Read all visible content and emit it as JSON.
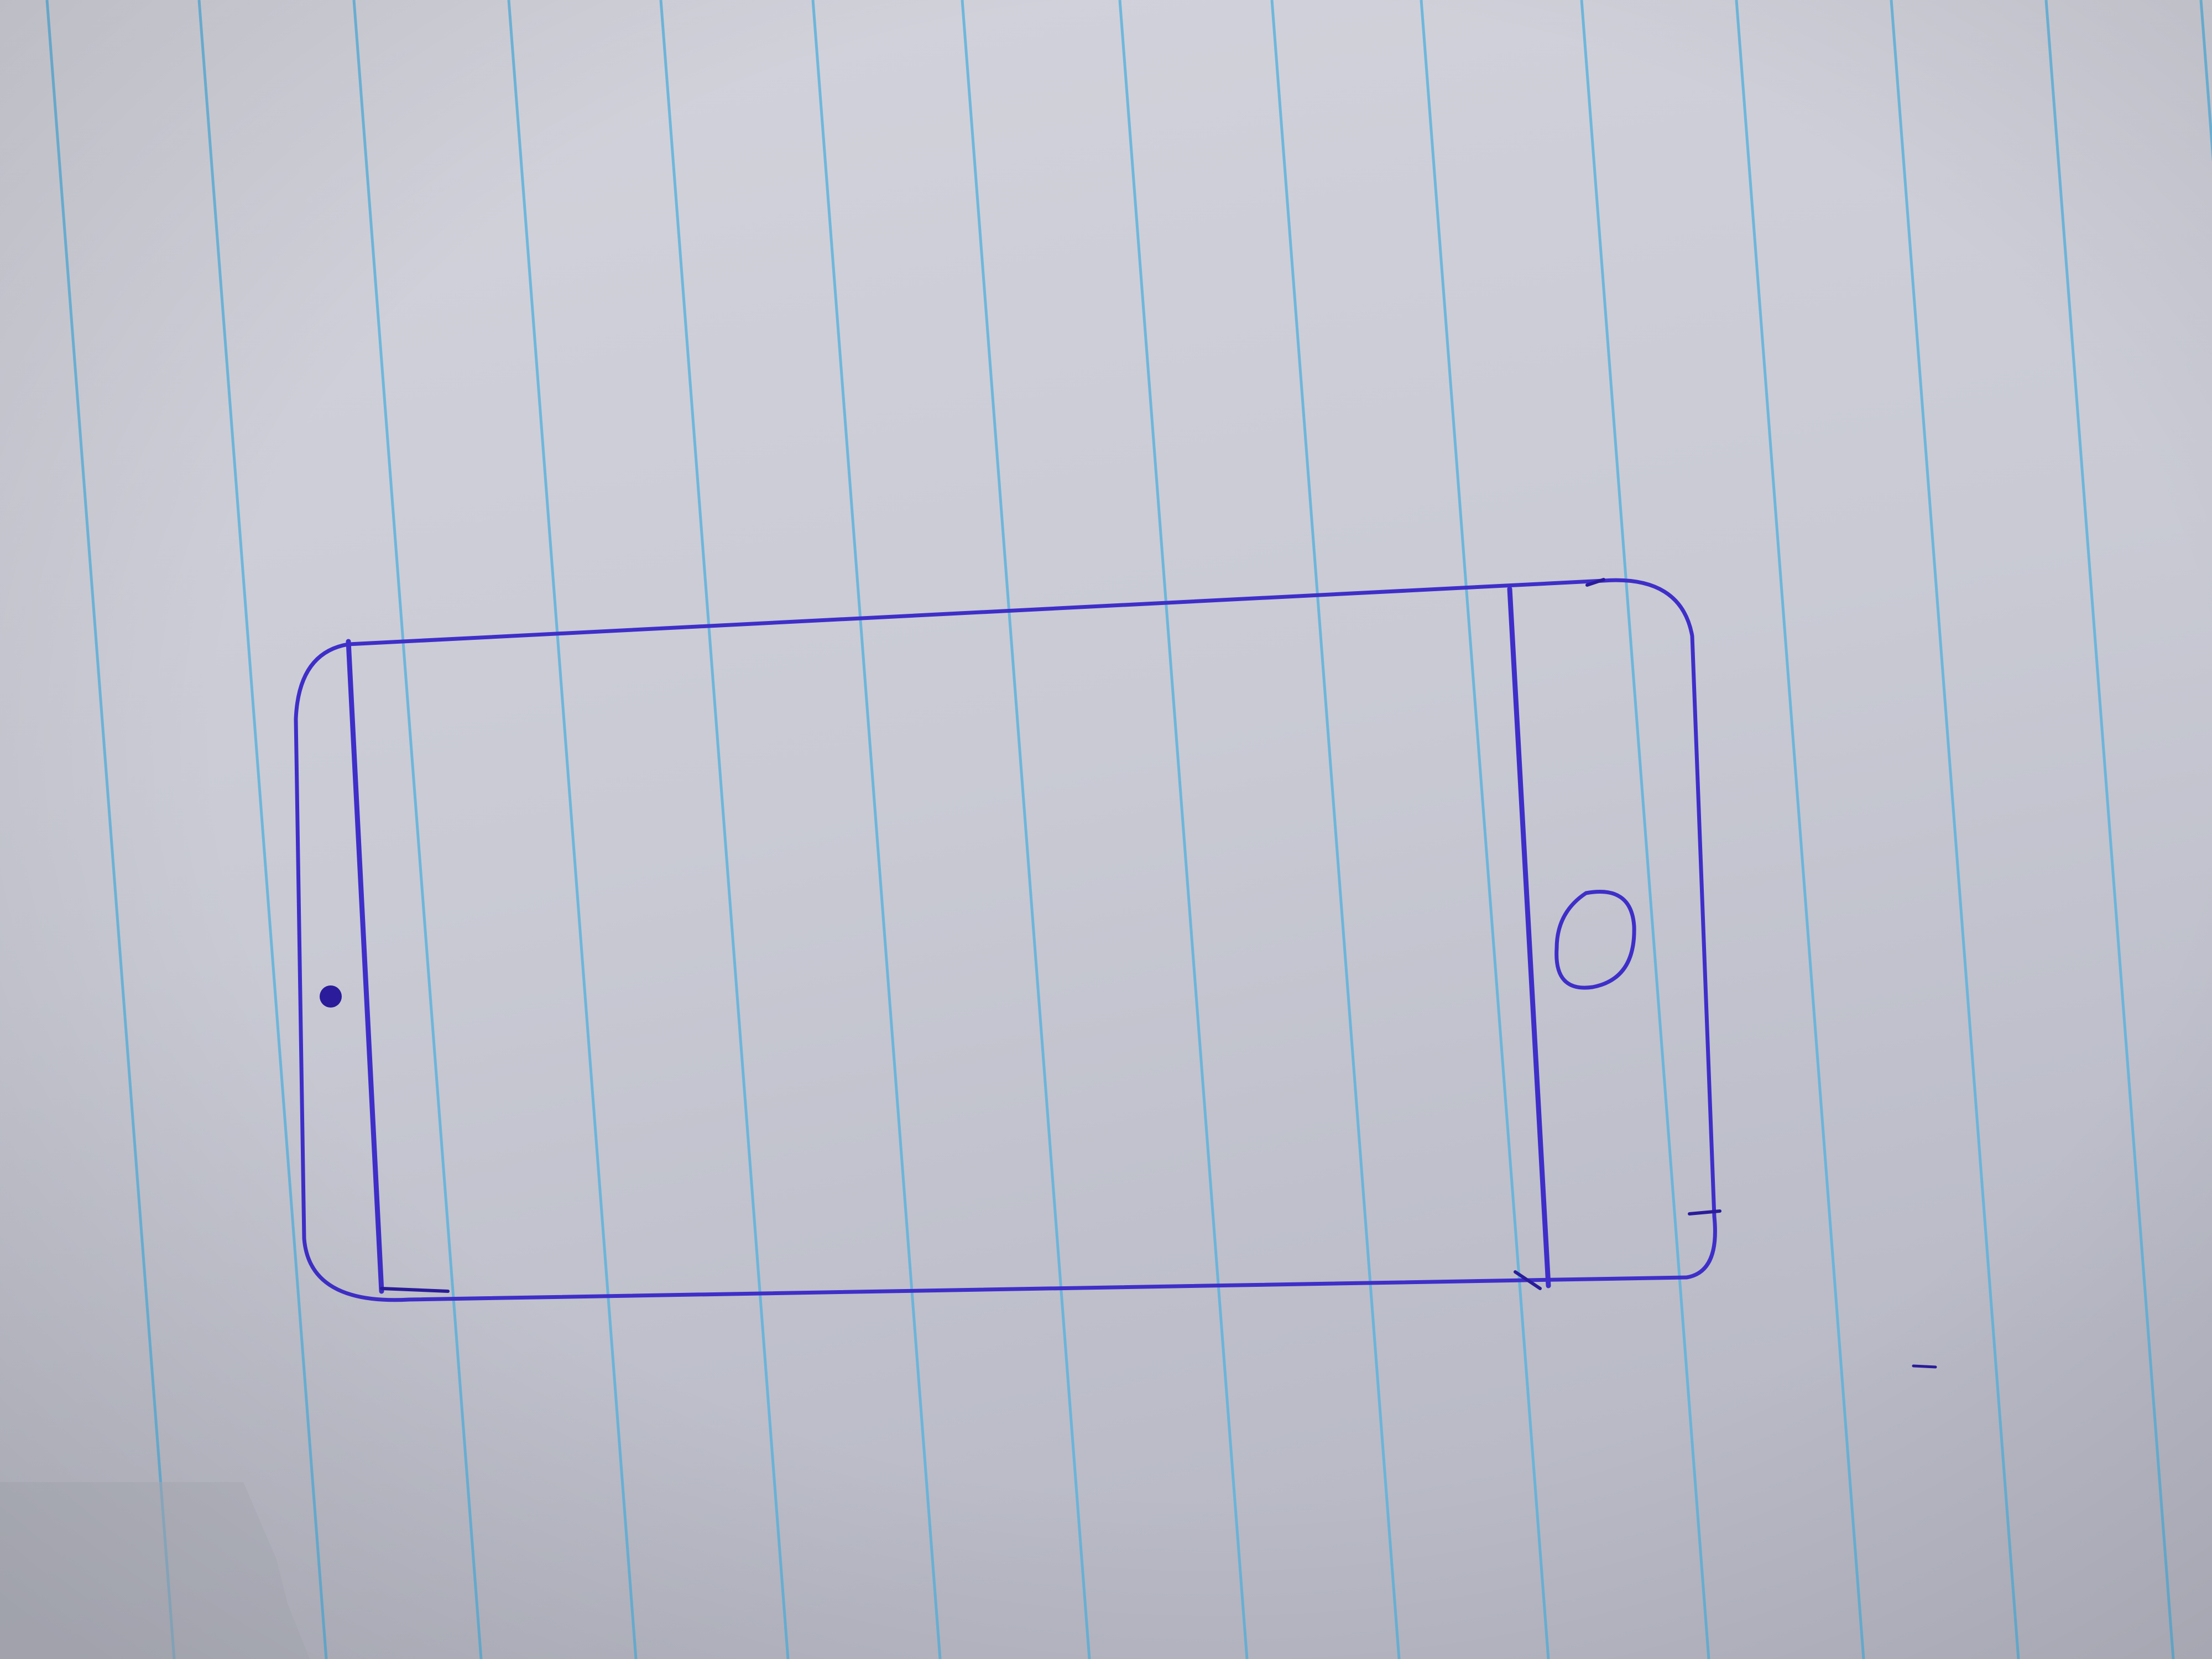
{
  "colors": {
    "paper_top": "#d3d3dc",
    "paper_mid": "#c9cad4",
    "paper_bottom": "#b9bac6",
    "rule_line": "#5fb3dc",
    "ink": "#3f2fc8",
    "ink_dark": "#2a1c9a"
  },
  "sketch": {
    "subject": "phone-outline",
    "elements": [
      "device-outline",
      "speaker-dot",
      "home-button"
    ]
  }
}
